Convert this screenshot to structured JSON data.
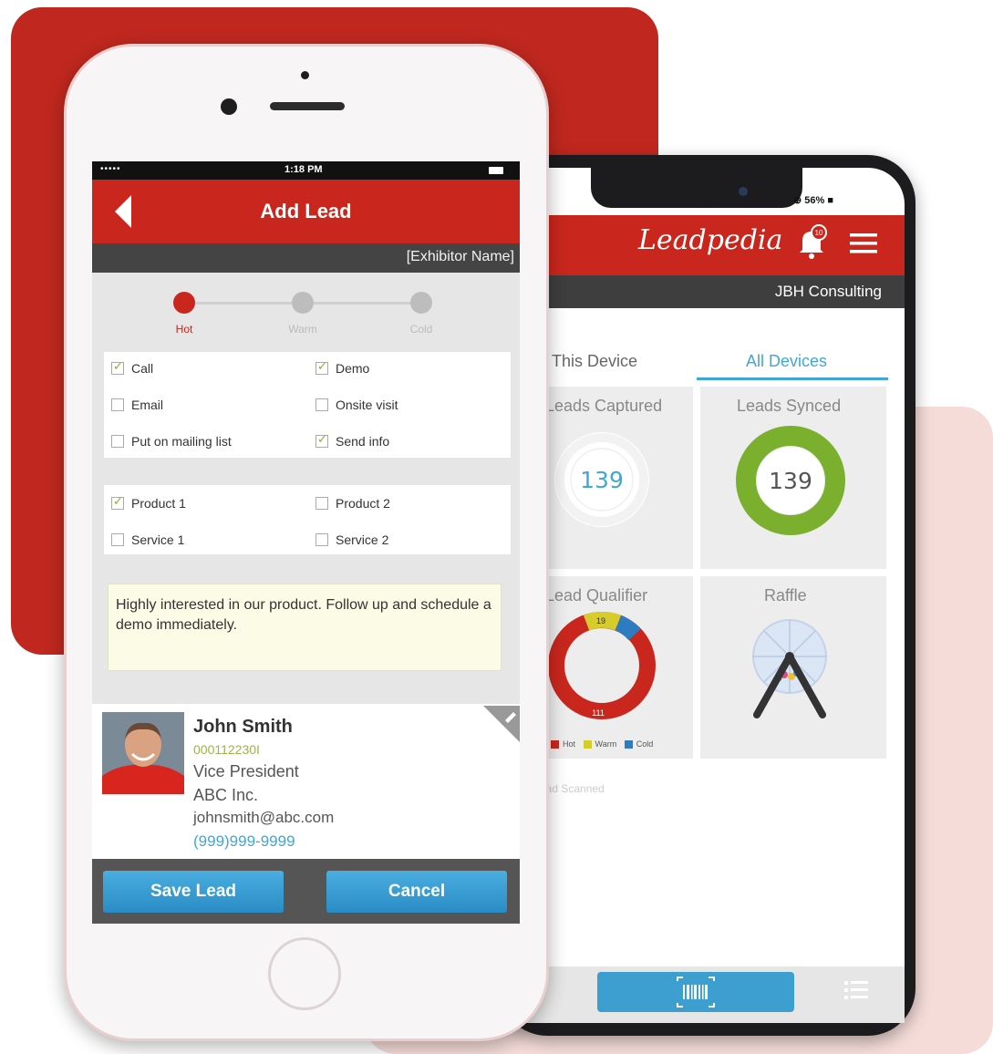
{
  "front_phone": {
    "status": {
      "signal": "•••••",
      "time": "1:18 PM"
    },
    "header": {
      "title": "Add Lead"
    },
    "subbar": {
      "exhibitor": "[Exhibitor Name]"
    },
    "temperature": {
      "options": [
        "Hot",
        "Warm",
        "Cold"
      ],
      "selected": "Hot",
      "selected_color": "#c9271d"
    },
    "actions": [
      {
        "label": "Call",
        "checked": true
      },
      {
        "label": "Demo",
        "checked": true
      },
      {
        "label": "Email",
        "checked": false
      },
      {
        "label": "Onsite visit",
        "checked": false
      },
      {
        "label": "Put on mailing list",
        "checked": false
      },
      {
        "label": "Send info",
        "checked": true
      }
    ],
    "products": [
      {
        "label": "Product 1",
        "checked": true
      },
      {
        "label": "Product 2",
        "checked": false
      },
      {
        "label": "Service 1",
        "checked": false
      },
      {
        "label": "Service 2",
        "checked": false
      }
    ],
    "notes": "Highly interested in our product. Follow up and schedule a demo immediately.",
    "contact": {
      "name": "John Smith",
      "id": "000112230I",
      "title": "Vice President",
      "company": "ABC Inc.",
      "email": "johnsmith@abc.com",
      "phone": "(999)999-9999"
    },
    "buttons": {
      "save": "Save Lead",
      "cancel": "Cancel"
    }
  },
  "back_phone": {
    "status": {
      "battery": "⊕ 56% ■"
    },
    "brand": "Leadpedia",
    "notification_count": "10",
    "company": "JBH Consulting",
    "tabs": [
      {
        "label": "This Device",
        "active": false
      },
      {
        "label": "All Devices",
        "active": true
      }
    ],
    "cards": {
      "leads_captured": {
        "title": "Leads Captured",
        "value": "139"
      },
      "leads_synced": {
        "title": "Leads Synced",
        "value": "139"
      },
      "lead_qualifier": {
        "title": "Lead Qualifier",
        "warm_label": "19",
        "hot_label": "111"
      },
      "raffle": {
        "title": "Raffle"
      }
    },
    "legend": [
      "Hot",
      "Warm",
      "Cold"
    ],
    "scanned_text": "ead Scanned"
  },
  "colors": {
    "brand_red": "#c9271d",
    "accent_blue": "#3fa7d6",
    "synced_green": "#7ab02e",
    "warm_yellow": "#d6cc2c",
    "cold_blue": "#2e7cc0",
    "backdrop_red": "#c0281f",
    "backdrop_pink": "#f5dcd8"
  }
}
